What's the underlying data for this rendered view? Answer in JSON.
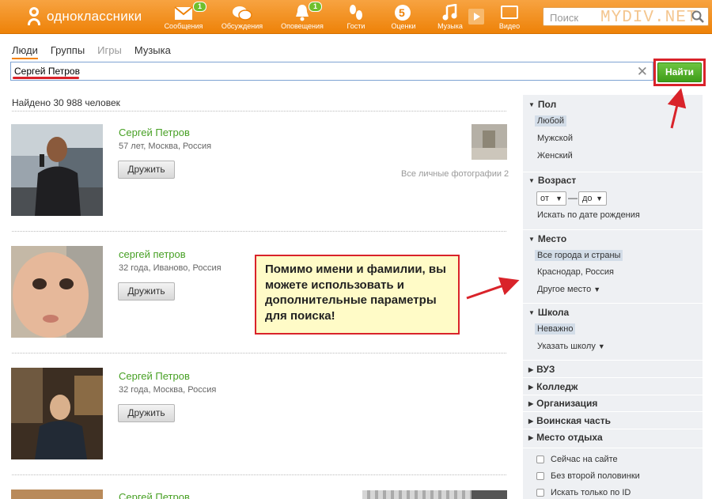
{
  "header": {
    "logo_text": "одноклассники",
    "nav": [
      {
        "label": "Сообщения",
        "icon": "envelope-icon",
        "badge": "1"
      },
      {
        "label": "Обсуждения",
        "icon": "chat-bubbles-icon",
        "badge": ""
      },
      {
        "label": "Оповещения",
        "icon": "bell-icon",
        "badge": "1"
      },
      {
        "label": "Гости",
        "icon": "footprints-icon",
        "badge": ""
      },
      {
        "label": "Оценки",
        "icon": "rating-five-icon",
        "badge": ""
      },
      {
        "label": "Музыка",
        "icon": "music-note-icon",
        "badge": ""
      },
      {
        "label": "Видео",
        "icon": "video-film-icon",
        "badge": ""
      }
    ],
    "search_placeholder": "Поиск",
    "watermark": "MYDIV.NET"
  },
  "tabs": [
    {
      "label": "Люди",
      "active": true
    },
    {
      "label": "Группы",
      "active": false
    },
    {
      "label": "Игры",
      "active": false
    },
    {
      "label": "Музыка",
      "active": false
    }
  ],
  "search": {
    "value": "Сергей Петров",
    "clear_symbol": "✕",
    "button_label": "Найти"
  },
  "results": {
    "found_text": "Найдено 30 988 человек",
    "friend_button": "Дружить",
    "all_photos_text": "Все личные фотографии 2",
    "items": [
      {
        "name": "Сергей Петров",
        "meta": "57 лет, Москва, Россия"
      },
      {
        "name": "сергей петров",
        "meta": "32 года, Иваново, Россия"
      },
      {
        "name": "Сергей Петров",
        "meta": "32 года, Москва, Россия"
      },
      {
        "name": "Сергей Петров",
        "meta": ""
      }
    ]
  },
  "callout": {
    "text": "Помимо имени и фамилии, вы можете использовать и дополнительные параметры для поиска!",
    "bg_color": "#fffbc7",
    "border_color": "#d9232a"
  },
  "filters": {
    "gender": {
      "title": "Пол",
      "options": [
        "Любой",
        "Мужской",
        "Женский"
      ],
      "selected": "Любой"
    },
    "age": {
      "title": "Возраст",
      "from": "от",
      "to": "до",
      "birth_date_link": "Искать по дате рождения"
    },
    "place": {
      "title": "Место",
      "options": [
        "Все города и страны",
        "Краснодар, Россия"
      ],
      "other": "Другое место",
      "selected": "Все города и страны"
    },
    "school": {
      "title": "Школа",
      "selected": "Неважно",
      "specify": "Указать школу"
    },
    "collapsed": [
      "ВУЗ",
      "Колледж",
      "Организация",
      "Воинская часть",
      "Место отдыха"
    ],
    "checkboxes": [
      "Сейчас на сайте",
      "Без второй половинки",
      "Искать только по ID"
    ]
  },
  "colors": {
    "brand_orange": "#ee8208",
    "link_green": "#47a024",
    "accent_red": "#d9232a",
    "button_green": "#3f9d1a"
  }
}
